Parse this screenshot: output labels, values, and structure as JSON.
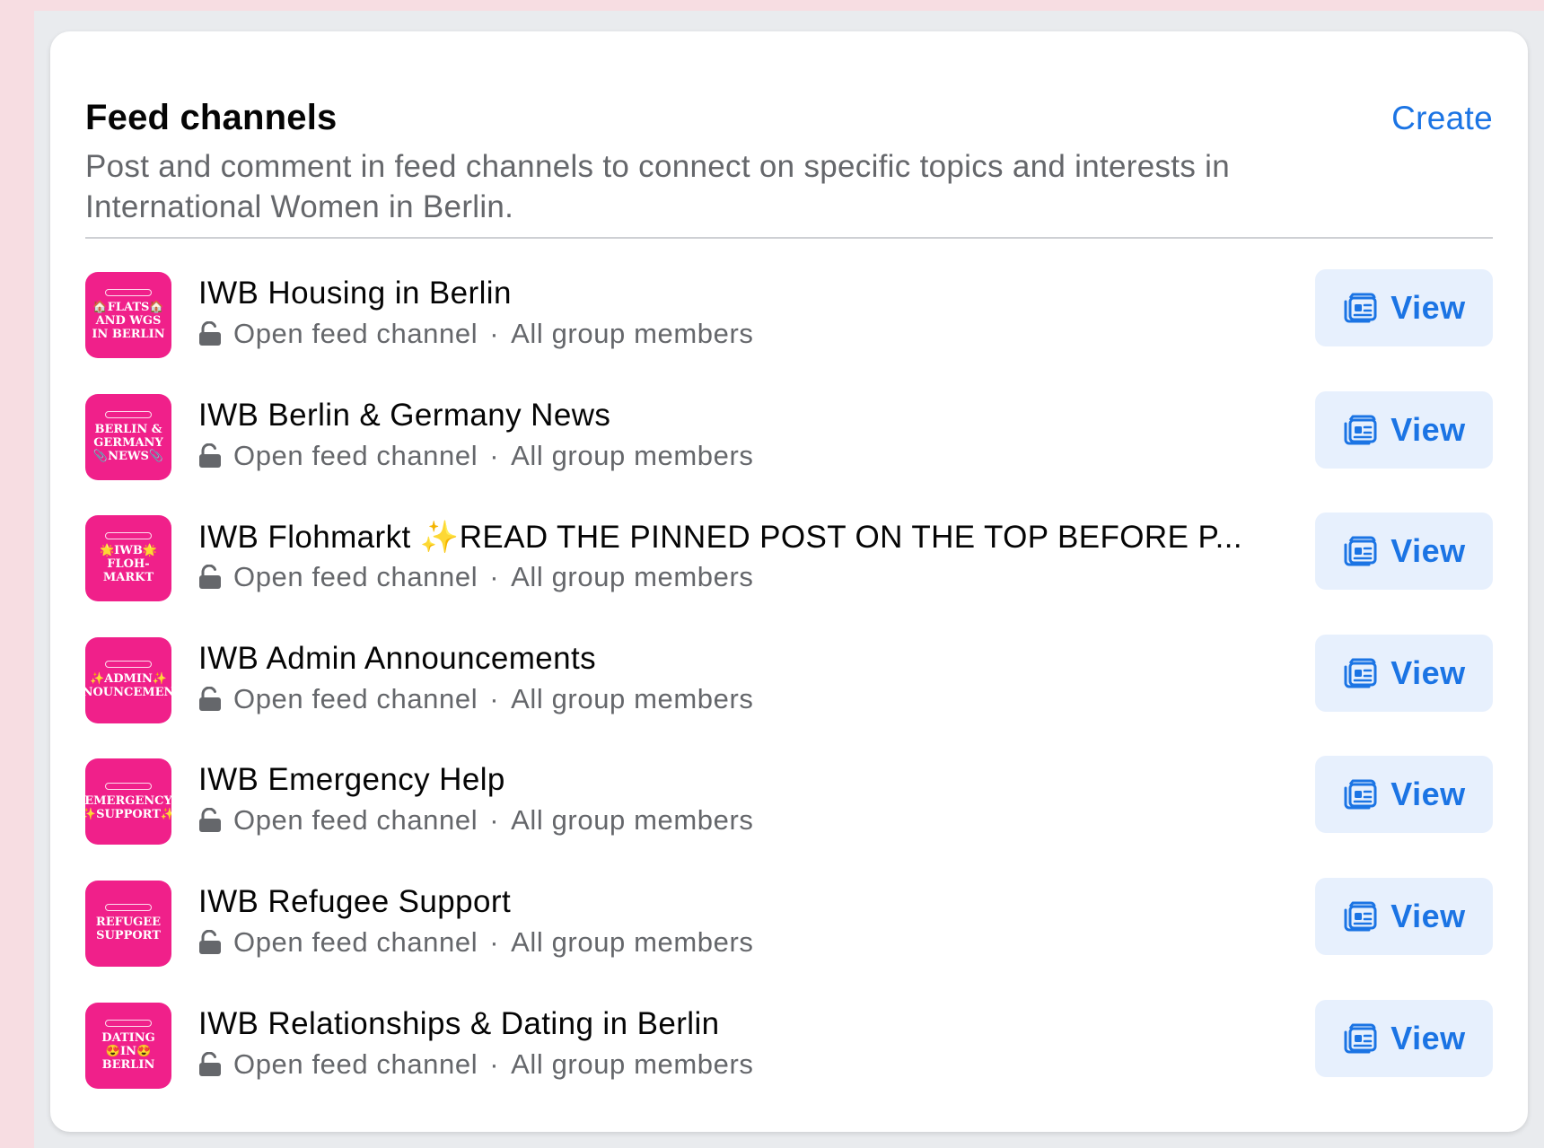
{
  "section": {
    "title": "Feed channels",
    "create_label": "Create",
    "description": "Post and comment in feed channels to connect on specific topics and interests in International Women in Berlin."
  },
  "channels": [
    {
      "name": "IWB Housing in Berlin",
      "thumb_text": "🏠FLATS🏠\nAND WGS\nIN BERLIN",
      "privacy": "Open feed channel",
      "audience": "All group members",
      "button_label": "View"
    },
    {
      "name": "IWB Berlin & Germany News",
      "thumb_text": "BERLIN &\nGERMANY\n📎NEWS📎",
      "privacy": "Open feed channel",
      "audience": "All group members",
      "button_label": "View"
    },
    {
      "name": "IWB Flohmarkt ✨READ THE PINNED POST ON THE TOP BEFORE P...",
      "thumb_text": "🌟IWB🌟\nFLOH-\nMARKT",
      "privacy": "Open feed channel",
      "audience": "All group members",
      "button_label": "View"
    },
    {
      "name": "IWB Admin Announcements",
      "thumb_text": "✨ADMIN✨\nNOUNCEMEN",
      "privacy": "Open feed channel",
      "audience": "All group members",
      "button_label": "View"
    },
    {
      "name": "IWB Emergency Help",
      "thumb_text": "EMERGENCY\n✨SUPPORT✨",
      "privacy": "Open feed channel",
      "audience": "All group members",
      "button_label": "View"
    },
    {
      "name": "IWB Refugee Support",
      "thumb_text": "REFUGEE\nSUPPORT",
      "privacy": "Open feed channel",
      "audience": "All group members",
      "button_label": "View"
    },
    {
      "name": "IWB Relationships & Dating in Berlin",
      "thumb_text": "DATING\n😍IN😍\nBERLIN",
      "privacy": "Open feed channel",
      "audience": "All group members",
      "button_label": "View"
    }
  ],
  "meta_separator": "·",
  "icons": {
    "privacy": "unlocked-lock-icon",
    "view": "feed-channel-icon"
  },
  "colors": {
    "accent": "#1b74e4",
    "button_bg": "#e7f0fd",
    "thumb_bg": "#f0208a",
    "secondary_text": "#65676b"
  }
}
